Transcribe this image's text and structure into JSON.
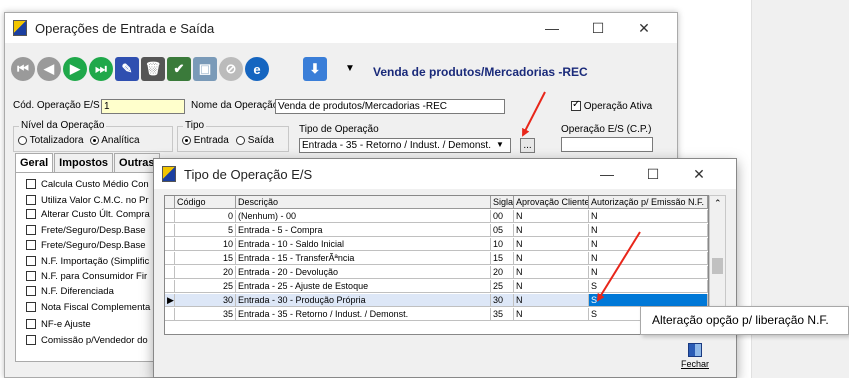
{
  "back_window": {
    "title": "Operações de Entrada e Saída",
    "operation_title": "Venda de produtos/Mercadorias -REC",
    "form": {
      "cod_label": "Cód. Operação E/S",
      "cod_value": "1",
      "nome_label": "Nome da Operação",
      "nome_value": "Venda de produtos/Mercadorias -REC",
      "ativa_label": "Operação Ativa",
      "nivel_label": "Nível da Operação",
      "nivel_totalizadora": "Totalizadora",
      "nivel_analitica": "Analítica",
      "tipo_label": "Tipo",
      "tipo_entrada": "Entrada",
      "tipo_saida": "Saída",
      "tipo_operacao_label": "Tipo de Operação",
      "tipo_operacao_value": "Entrada - 35 - Retorno / Indust. / Demonst.",
      "cp_label": "Operação E/S (C.P.)",
      "browse_label": "..."
    },
    "tabs": [
      "Geral",
      "Impostos",
      "Outras"
    ],
    "options": [
      "Calcula Custo Médio Con",
      "Utiliza Valor C.M.C. no Pr",
      "Alterar Custo Últ. Compra",
      "Frete/Seguro/Desp.Base",
      "Frete/Seguro/Desp.Base",
      "N.F. Importação (Simplific",
      "N.F. para Consumidor Fir",
      "N.F. Diferenciada",
      "Nota Fiscal Complementa",
      "NF-e Ajuste",
      "Comissão p/Vendedor do"
    ]
  },
  "front_window": {
    "title": "Tipo de Operação E/S",
    "columns": [
      "Código",
      "Descrição",
      "Sigla",
      "Aprovação Cliente",
      "Autorização p/ Emissão N.F."
    ],
    "rows": [
      [
        "0",
        "(Nenhum) - 00",
        "00",
        "N",
        "N"
      ],
      [
        "5",
        "Entrada - 5 - Compra",
        "05",
        "N",
        "N"
      ],
      [
        "10",
        "Entrada - 10 - Saldo Inicial",
        "10",
        "N",
        "N"
      ],
      [
        "15",
        "Entrada - 15 - TransferÃªncia",
        "15",
        "N",
        "N"
      ],
      [
        "20",
        "Entrada - 20 - Devolução",
        "20",
        "N",
        "N"
      ],
      [
        "25",
        "Entrada - 25 - Ajuste de Estoque",
        "25",
        "N",
        "S"
      ],
      [
        "30",
        "Entrada - 30 - Produção Própria",
        "30",
        "N",
        "S"
      ],
      [
        "35",
        "Entrada - 35 - Retorno / Indust. / Demonst.",
        "35",
        "N",
        "S"
      ]
    ],
    "selected_row": 6,
    "close_label": "Fechar"
  },
  "tooltip": "Alteração opção p/ liberação N.F.",
  "colors": {
    "selection": "#0078d7",
    "arrow": "#e8261a",
    "title_blue": "#1a2a7a"
  }
}
